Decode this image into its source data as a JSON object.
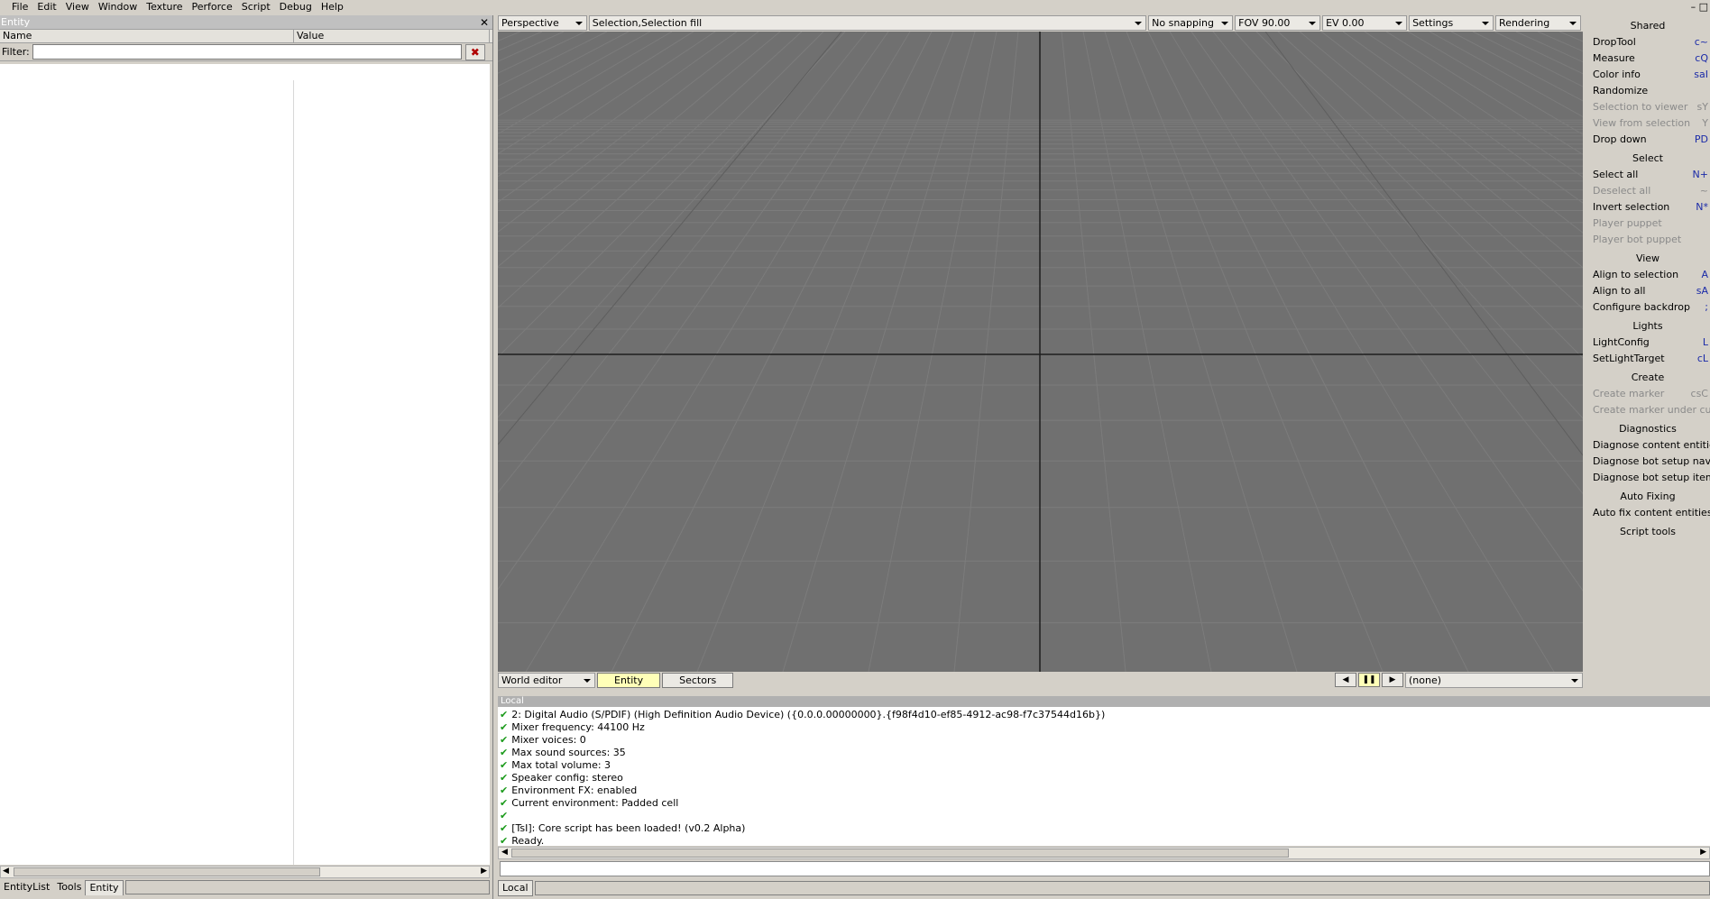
{
  "menu": [
    "File",
    "Edit",
    "View",
    "Window",
    "Texture",
    "Perforce",
    "Script",
    "Debug",
    "Help"
  ],
  "window_controls": "– □",
  "entity_panel": {
    "title": "Entity",
    "close": "✕",
    "col_name": "Name",
    "col_value": "Value",
    "filter_label": "Filter:",
    "filter_value": "",
    "clear_icon": "✖",
    "tabs": [
      "EntityList",
      "Tools",
      "Entity"
    ],
    "active_tab": "Entity"
  },
  "viewport_toolbar": {
    "camera": "Perspective",
    "selection_mode": "Selection,Selection fill",
    "snapping": "No snapping",
    "fov": "FOV 90.00",
    "ev": "EV  0.00",
    "settings": "Settings",
    "rendering": "Rendering"
  },
  "viewport_bottom": {
    "editor_mode": "World editor",
    "tab_entity": "Entity",
    "tab_sectors": "Sectors",
    "prev": "◀",
    "pause": "❚❚",
    "next": "▶",
    "target": "(none)"
  },
  "tools_panel": {
    "sections": [
      {
        "title": "Shared",
        "items": [
          {
            "label": "DropTool",
            "shortcut": "c~",
            "disabled": false
          },
          {
            "label": "Measure",
            "shortcut": "cQ",
            "disabled": false
          },
          {
            "label": "Color info",
            "shortcut": "saI",
            "disabled": false
          },
          {
            "label": "Randomize",
            "shortcut": "",
            "disabled": false
          },
          {
            "label": "Selection to viewer",
            "shortcut": "sY",
            "disabled": true
          },
          {
            "label": "View from selection",
            "shortcut": "Y",
            "disabled": true
          },
          {
            "label": "Drop down",
            "shortcut": "PD",
            "disabled": false
          }
        ]
      },
      {
        "title": "Select",
        "items": [
          {
            "label": "Select all",
            "shortcut": "N+",
            "disabled": false
          },
          {
            "label": "Deselect all",
            "shortcut": "~",
            "disabled": true
          },
          {
            "label": "Invert selection",
            "shortcut": "N*",
            "disabled": false
          },
          {
            "label": "Player puppet",
            "shortcut": "",
            "disabled": true
          },
          {
            "label": "Player bot puppet",
            "shortcut": "",
            "disabled": true
          }
        ]
      },
      {
        "title": "View",
        "items": [
          {
            "label": "Align to selection",
            "shortcut": "A",
            "disabled": false
          },
          {
            "label": "Align to all",
            "shortcut": "sA",
            "disabled": false
          },
          {
            "label": "Configure backdrop",
            "shortcut": ";",
            "disabled": false
          }
        ]
      },
      {
        "title": "Lights",
        "items": [
          {
            "label": "LightConfig",
            "shortcut": "L",
            "disabled": false
          },
          {
            "label": "SetLightTarget",
            "shortcut": "cL",
            "disabled": false
          }
        ]
      },
      {
        "title": "Create",
        "items": [
          {
            "label": "Create marker",
            "shortcut": "csC",
            "disabled": true
          },
          {
            "label": "Create marker under cursor",
            "shortcut": "",
            "disabled": true
          }
        ]
      },
      {
        "title": "Diagnostics",
        "items": [
          {
            "label": "Diagnose content entities",
            "shortcut": "",
            "disabled": false
          },
          {
            "label": "Diagnose bot setup navigation",
            "shortcut": "",
            "disabled": false
          },
          {
            "label": "Diagnose bot setup items",
            "shortcut": "",
            "disabled": false
          }
        ]
      },
      {
        "title": "Auto Fixing",
        "items": [
          {
            "label": "Auto fix content entities",
            "shortcut": "",
            "disabled": false
          }
        ]
      },
      {
        "title": "Script tools",
        "items": []
      }
    ]
  },
  "console": {
    "title": "Local",
    "lines": [
      "2: Digital Audio (S/PDIF) (High Definition Audio Device) ({0.0.0.00000000}.{f98f4d10-ef85-4912-ac98-f7c37544d16b})",
      "Mixer frequency: 44100 Hz",
      "Mixer voices: 0",
      "Max sound sources: 35",
      "Max total volume: 3",
      "Speaker config: stereo",
      "Environment FX: enabled",
      "Current environment: Padded cell",
      "",
      "[TsI]: Core script has been loaded! (v0.2 Alpha)",
      "Ready."
    ],
    "check_icon": "✔",
    "tab": "Local"
  },
  "scroll_arrows": {
    "left": "◀",
    "right": "▶"
  }
}
